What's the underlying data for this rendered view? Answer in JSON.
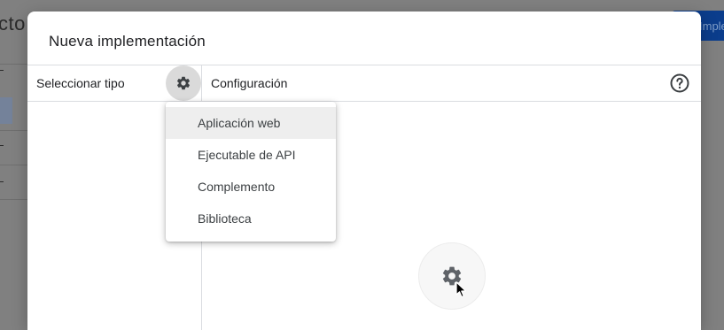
{
  "background": {
    "page_title_fragment": "cto",
    "primary_button_fragment": "Implem"
  },
  "dialog": {
    "title": "Nueva implementación",
    "select_type_label": "Seleccionar tipo",
    "configuration_label": "Configuración",
    "gear_icon": "gear-icon",
    "help_icon": "help-circle-icon"
  },
  "menu": {
    "items": [
      {
        "label": "Aplicación web",
        "highlighted": true
      },
      {
        "label": "Ejecutable de API",
        "highlighted": false
      },
      {
        "label": "Complemento",
        "highlighted": false
      },
      {
        "label": "Biblioteca",
        "highlighted": false
      }
    ]
  },
  "colors": {
    "scrim": "#808080",
    "dialog_bg": "#ffffff",
    "divider": "#dadce0",
    "gear_button_bg": "#dadada",
    "menu_highlight": "#eeeeee",
    "text": "#202124"
  }
}
